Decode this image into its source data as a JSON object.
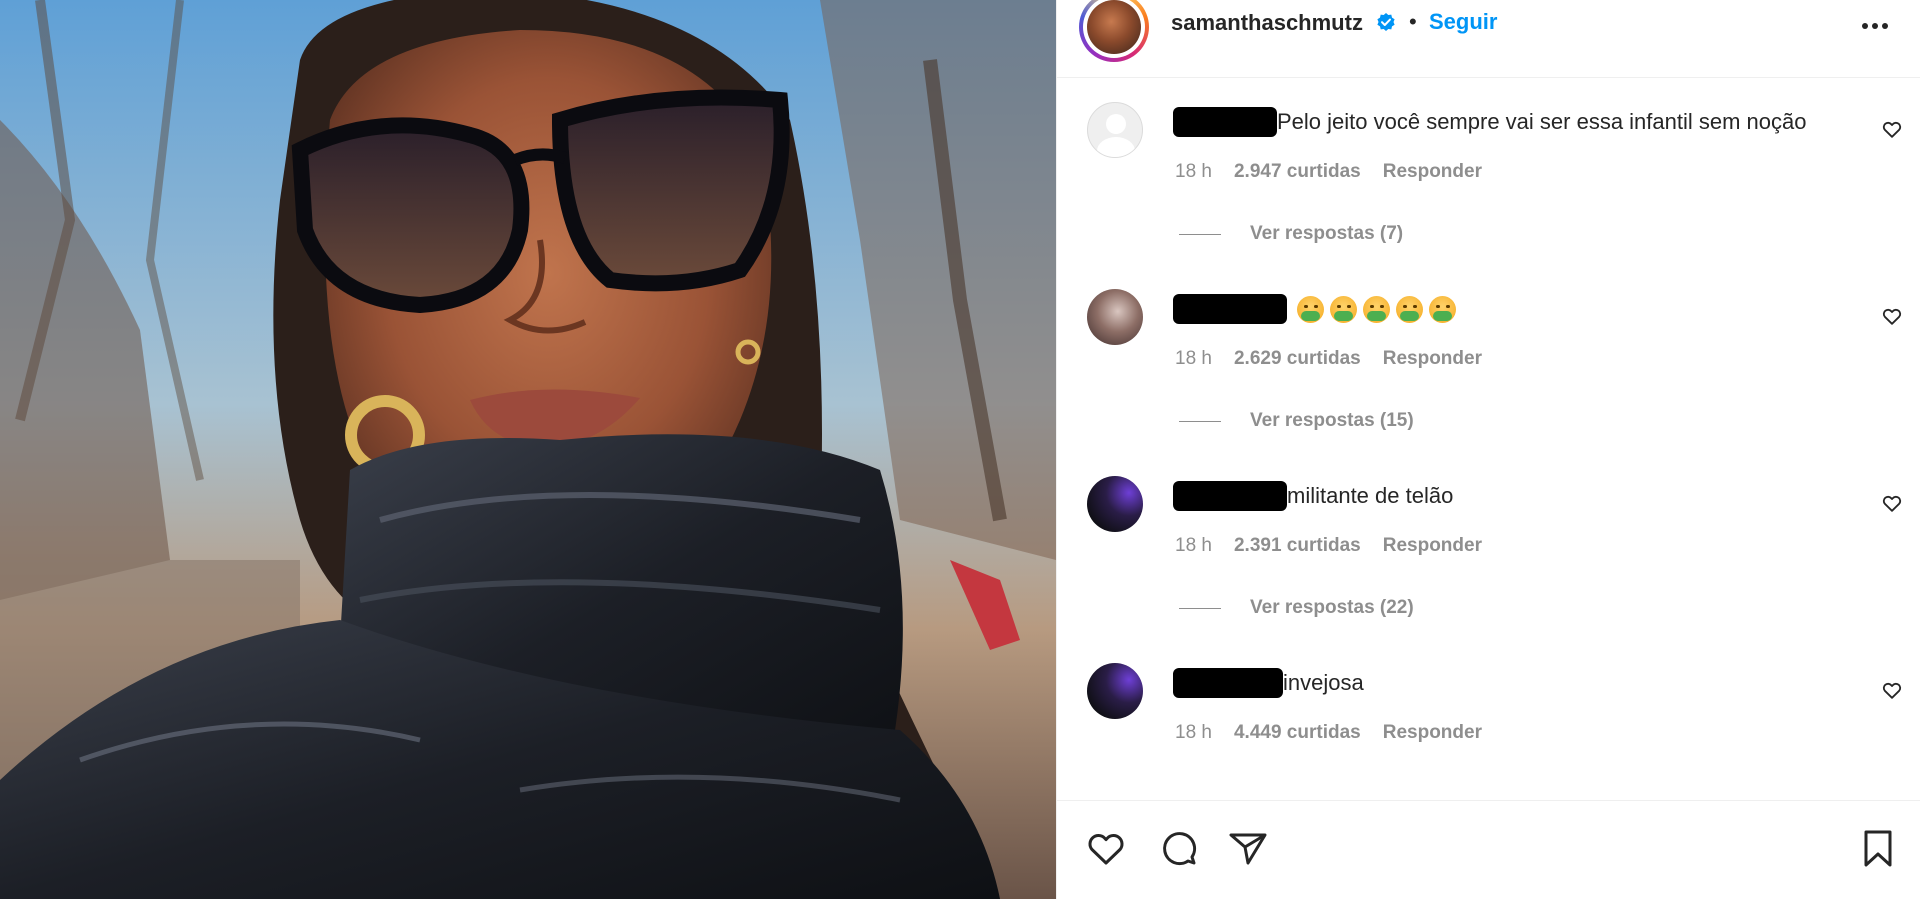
{
  "post": {
    "username": "samanthaschmutz",
    "follow_label": "Seguir",
    "separator": "•"
  },
  "comments": [
    {
      "text": "Pelo jeito você sempre vai ser essa infantil sem noção",
      "time": "18 h",
      "likes": "2.947 curtidas",
      "reply_label": "Responder",
      "replies_label": "Ver respostas (7)"
    },
    {
      "text": "",
      "emoji_count": 5,
      "emoji_icon": "nauseated-face-icon",
      "time": "18 h",
      "likes": "2.629 curtidas",
      "reply_label": "Responder",
      "replies_label": "Ver respostas (15)"
    },
    {
      "text": "militante de telão",
      "time": "18 h",
      "likes": "2.391 curtidas",
      "reply_label": "Responder",
      "replies_label": "Ver respostas (22)"
    },
    {
      "text": "invejosa",
      "time": "18 h",
      "likes": "4.449 curtidas",
      "reply_label": "Responder"
    }
  ],
  "icons": {
    "verified": "verified-badge-icon",
    "more": "more-options-icon",
    "like": "heart-icon",
    "comment": "comment-icon",
    "share": "share-icon",
    "save": "bookmark-icon"
  },
  "colors": {
    "accent": "#0095f6",
    "text": "#262626",
    "muted": "#8e8e8e",
    "border": "#efefef"
  }
}
